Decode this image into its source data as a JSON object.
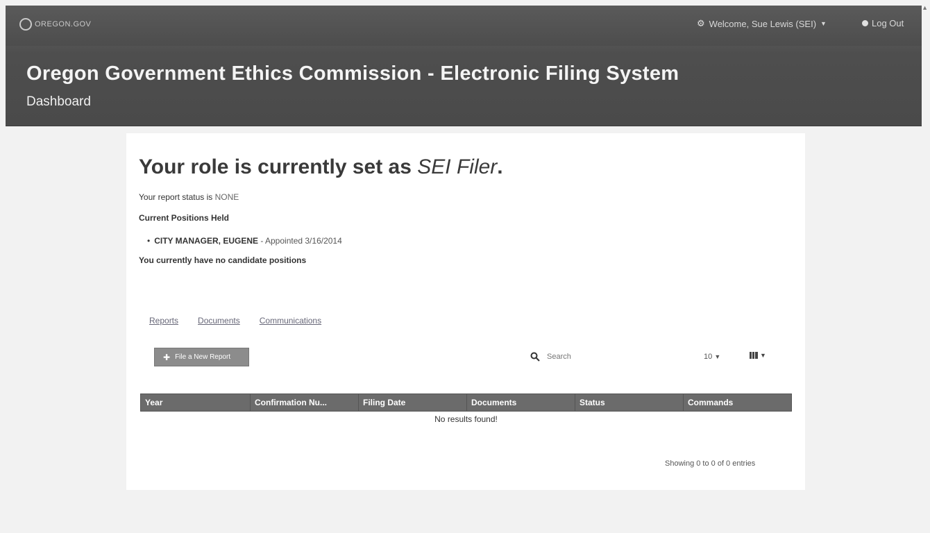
{
  "header": {
    "logo_text": "OREGON.GOV",
    "welcome_text": "Welcome, Sue Lewis (SEI)",
    "logout_label": "Log Out",
    "app_title": "Oregon Government Ethics Commission - Electronic Filing System",
    "page_subtitle": "Dashboard"
  },
  "role": {
    "heading_prefix": "Your role is currently set as ",
    "role_name": "SEI Filer",
    "heading_suffix": ".",
    "status_prefix": "Your report status is ",
    "status_value": "NONE",
    "positions_label": "Current Positions Held",
    "positions": [
      {
        "title": "CITY MANAGER, EUGENE",
        "detail": " - Appointed 3/16/2014"
      }
    ],
    "candidate_text": "You currently have no candidate positions"
  },
  "tabs": [
    "Reports",
    "Documents",
    "Communications"
  ],
  "toolbar": {
    "new_report_label": "File a New Report",
    "search_placeholder": "Search",
    "page_size": "10"
  },
  "table": {
    "columns": [
      "Year",
      "Confirmation Nu...",
      "Filing Date",
      "Documents",
      "Status",
      "Commands"
    ],
    "empty_message": "No results found!",
    "showing": "Showing 0 to 0 of 0 entries"
  },
  "icons": {
    "gear": "gear-icon",
    "logout": "logout-icon",
    "search": "search-icon",
    "plus": "plus-icon",
    "columns": "grid-icon"
  },
  "colors": {
    "header_bg": "#4e4e4e",
    "table_header_bg": "#6b6b6b",
    "button_bg": "#8c8c8c"
  }
}
